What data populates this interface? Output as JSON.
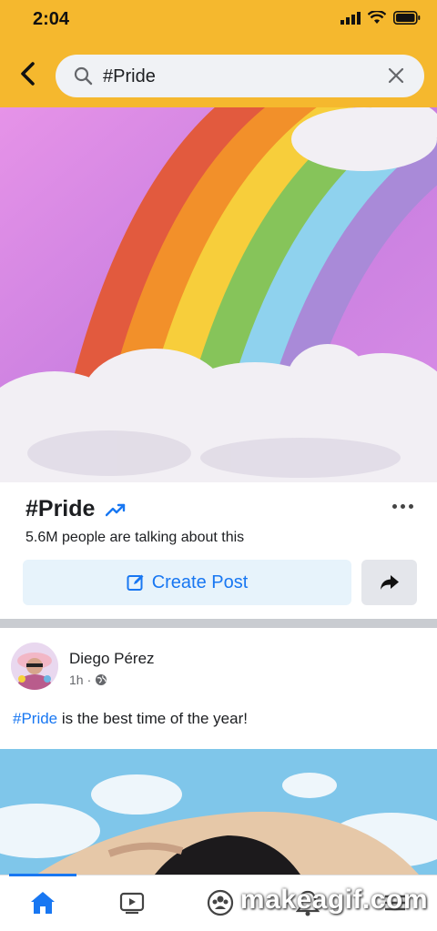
{
  "status": {
    "time": "2:04"
  },
  "search": {
    "value": "#Pride"
  },
  "topic": {
    "title": "#Pride",
    "subtitle": "5.6M people are talking about this",
    "create_label": "Create Post"
  },
  "post": {
    "author": "Diego Pérez",
    "time": "1h",
    "hashtag": "#Pride",
    "text_rest": " is the best time of the year!"
  },
  "icons": {
    "back": "back-arrow-icon",
    "search": "search-icon",
    "clear": "close-icon",
    "trending": "trending-up-icon",
    "more": "more-dots-icon",
    "create": "edit-icon",
    "share": "share-arrow-icon",
    "privacy": "globe-icon",
    "tabs": [
      "home-icon",
      "video-icon",
      "groups-icon",
      "notifications-icon",
      "menu-icon"
    ]
  },
  "colors": {
    "header": "#f5b82e",
    "accent": "#1877f2"
  },
  "watermark": "makeagif.com"
}
